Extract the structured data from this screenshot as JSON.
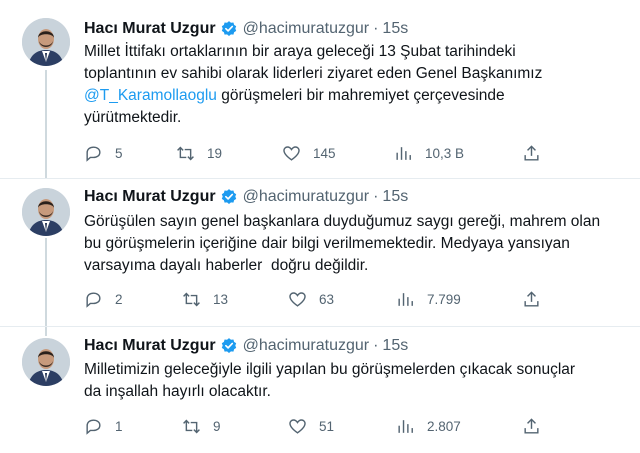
{
  "colors": {
    "accent": "#1d9bf0",
    "muted": "#536471",
    "text": "#0f1419",
    "divider": "#e6ecf0"
  },
  "tweets": [
    {
      "name": "Hacı Murat Uzgur",
      "handle": "@hacimuratuzgur",
      "separator": "·",
      "time": "15s",
      "text_lines": [
        "Millet İttifakı ortaklarının bir araya geleceği 13 Şubat tarihindeki",
        "toplantının ev sahibi olarak liderleri ziyaret eden Genel Başkanımız"
      ],
      "mention": "@T_Karamollaoglu",
      "text_after_mention": " görüşmeleri bir mahremiyet çerçevesinde",
      "text_last_line": "yürütmektedir.",
      "replies": "5",
      "retweets": "19",
      "likes": "145",
      "views": "10,3 B"
    },
    {
      "name": "Hacı Murat Uzgur",
      "handle": "@hacimuratuzgur",
      "separator": "·",
      "time": "15s",
      "text_lines": [
        "Görüşülen sayın genel başkanlara duyduğumuz saygı gereği, mahrem olan",
        "bu görüşmelerin içeriğine dair bilgi verilmemektedir. Medyaya yansıyan",
        "varsayıma dayalı haberler  doğru değildir."
      ],
      "replies": "2",
      "retweets": "13",
      "likes": "63",
      "views": "7.799"
    },
    {
      "name": "Hacı Murat Uzgur",
      "handle": "@hacimuratuzgur",
      "separator": "·",
      "time": "15s",
      "text_lines": [
        "Milletimizin geleceğiyle ilgili yapılan bu görüşmelerden çıkacak sonuçlar",
        "da inşallah hayırlı olacaktır."
      ],
      "replies": "1",
      "retweets": "9",
      "likes": "51",
      "views": "2.807"
    }
  ]
}
